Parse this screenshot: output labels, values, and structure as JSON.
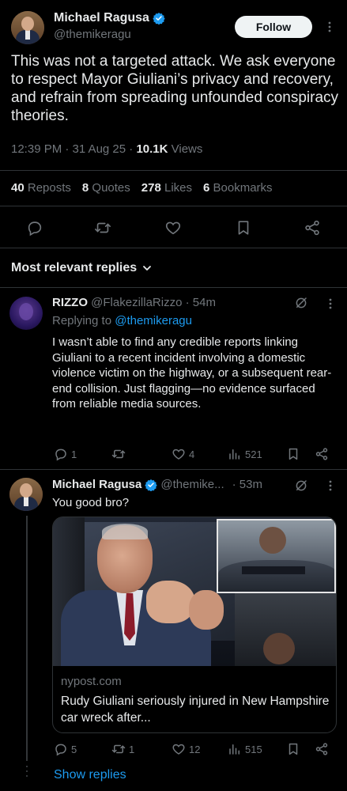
{
  "main_tweet": {
    "author_name": "Michael Ragusa",
    "author_handle": "@themikeragu",
    "follow_label": "Follow",
    "text": "This was not a targeted attack. We ask everyone to respect Mayor Giuliani’s privacy and recovery, and refrain from spreading unfounded conspiracy theories.",
    "time": "12:39 PM · 31 Aug 25 · ",
    "views_count": "10.1K",
    "views_label": " Views",
    "stats": [
      {
        "count": "40",
        "label": "Reposts"
      },
      {
        "count": "8",
        "label": "Quotes"
      },
      {
        "count": "278",
        "label": "Likes"
      },
      {
        "count": "6",
        "label": "Bookmarks"
      }
    ]
  },
  "replies_section": {
    "title": "Most relevant replies"
  },
  "reply1": {
    "name": "RIZZO",
    "handle": "@FlakezillaRizzo",
    "time": "· 54m",
    "replying_prefix": "Replying to ",
    "replying_handle": "@themikeragu",
    "text": "I wasn’t able to find any credible reports linking Giuliani to a recent incident involving a domestic violence victim on the highway, or a subsequent rear-end collision. Just flagging—no evidence surfaced from reliable media sources.",
    "replies": "1",
    "reposts": "",
    "likes": "4",
    "views": "521"
  },
  "reply2": {
    "name": "Michael Ragusa",
    "handle": "@themike...",
    "time": "· 53m",
    "text": "You good bro?",
    "card_source": "nypost.com",
    "card_title": "Rudy Giuliani seriously injured in New Hampshire car wreck after...",
    "replies": "5",
    "reposts": "1",
    "likes": "12",
    "views": "515"
  },
  "show_replies_label": "Show replies",
  "colors": {
    "background": "#000000",
    "text": "#e7e9ea",
    "muted": "#71767b",
    "accent": "#1d9bf0",
    "divider": "#2f3336"
  },
  "icons": [
    "verified-badge-icon",
    "more-icon",
    "reply-icon",
    "repost-icon",
    "like-icon",
    "bookmark-icon",
    "share-icon",
    "grok-icon",
    "views-icon",
    "chevron-down-icon"
  ]
}
